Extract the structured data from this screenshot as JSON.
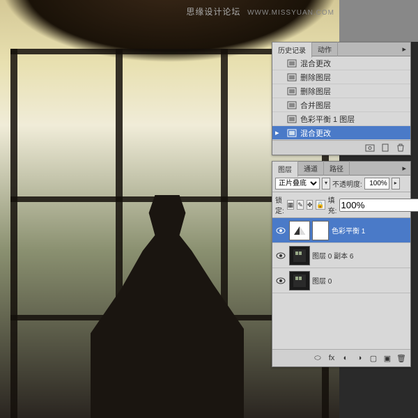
{
  "watermark": {
    "cn": "思缘设计论坛",
    "url": "WWW.MISSYUAN.COM"
  },
  "history_panel": {
    "tabs": {
      "history": "历史记录",
      "actions": "动作"
    },
    "items": [
      {
        "label": "混合更改",
        "selected": false
      },
      {
        "label": "删除图层",
        "selected": false
      },
      {
        "label": "删除图层",
        "selected": false
      },
      {
        "label": "合并图层",
        "selected": false
      },
      {
        "label": "色彩平衡 1 图层",
        "selected": false
      },
      {
        "label": "混合更改",
        "selected": true
      }
    ]
  },
  "layers_panel": {
    "tabs": {
      "layers": "图层",
      "channels": "通道",
      "paths": "路径"
    },
    "blend_mode": "正片叠底",
    "opacity_label": "不透明度:",
    "opacity_value": "100%",
    "lock_label": "锁定:",
    "fill_label": "填充:",
    "fill_value": "100%",
    "layers": [
      {
        "name": "色彩平衡 1",
        "selected": true,
        "adjustment": true
      },
      {
        "name": "图层 0 副本 6",
        "selected": false,
        "adjustment": false
      },
      {
        "name": "图层 0",
        "selected": false,
        "adjustment": false
      }
    ]
  }
}
